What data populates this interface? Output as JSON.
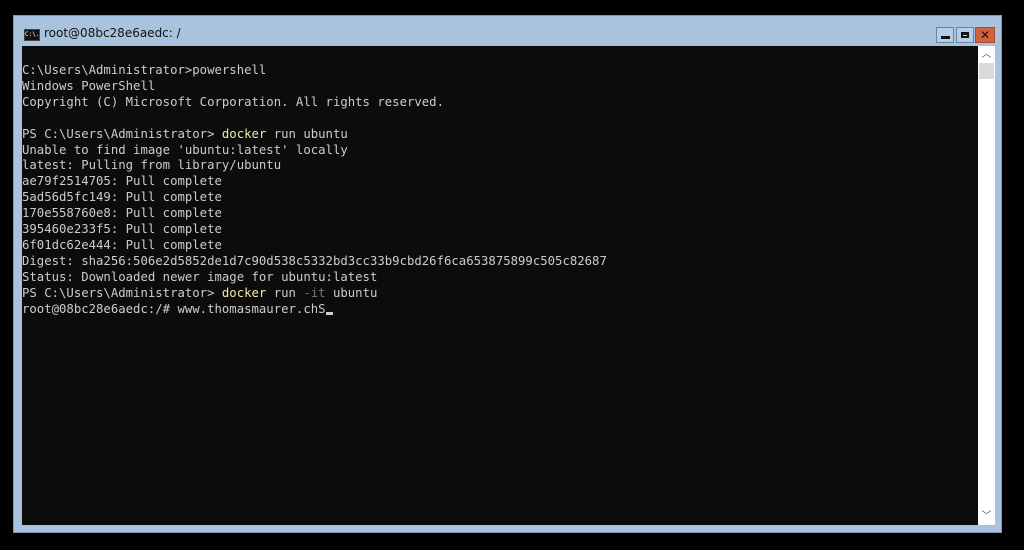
{
  "window": {
    "title": "root@08bc28e6aedc: /",
    "icon": "console-icon",
    "icon_text": "C:\\.",
    "controls": {
      "minimize": "minimize-icon",
      "maximize": "maximize-icon",
      "close": "close-icon",
      "close_glyph": "✕"
    }
  },
  "console": {
    "lines": [
      {
        "text": "C:\\Users\\Administrator>powershell"
      },
      {
        "text": "Windows PowerShell"
      },
      {
        "text": "Copyright (C) Microsoft Corporation. All rights reserved."
      },
      {
        "text": ""
      },
      {
        "prompt": "PS C:\\Users\\Administrator> ",
        "cmd": "docker",
        "rest": " run ubuntu"
      },
      {
        "text": "Unable to find image 'ubuntu:latest' locally"
      },
      {
        "text": "latest: Pulling from library/ubuntu"
      },
      {
        "text": "ae79f2514705: Pull complete"
      },
      {
        "text": "5ad56d5fc149: Pull complete"
      },
      {
        "text": "170e558760e8: Pull complete"
      },
      {
        "text": "395460e233f5: Pull complete"
      },
      {
        "text": "6f01dc62e444: Pull complete"
      },
      {
        "text": "Digest: sha256:506e2d5852de1d7c90d538c5332bd3cc33b9cbd26f6ca653875899c505c82687"
      },
      {
        "text": "Status: Downloaded newer image for ubuntu:latest"
      },
      {
        "prompt": "PS C:\\Users\\Administrator> ",
        "cmd": "docker",
        "mid": " run ",
        "param": "-it",
        "rest": " ubuntu"
      },
      {
        "text": "root@08bc28e6aedc:/# www.thomasmaurer.chS",
        "cursor": true
      }
    ]
  },
  "scrollbar": {
    "up_glyph": "︿",
    "down_glyph": "﹀"
  }
}
